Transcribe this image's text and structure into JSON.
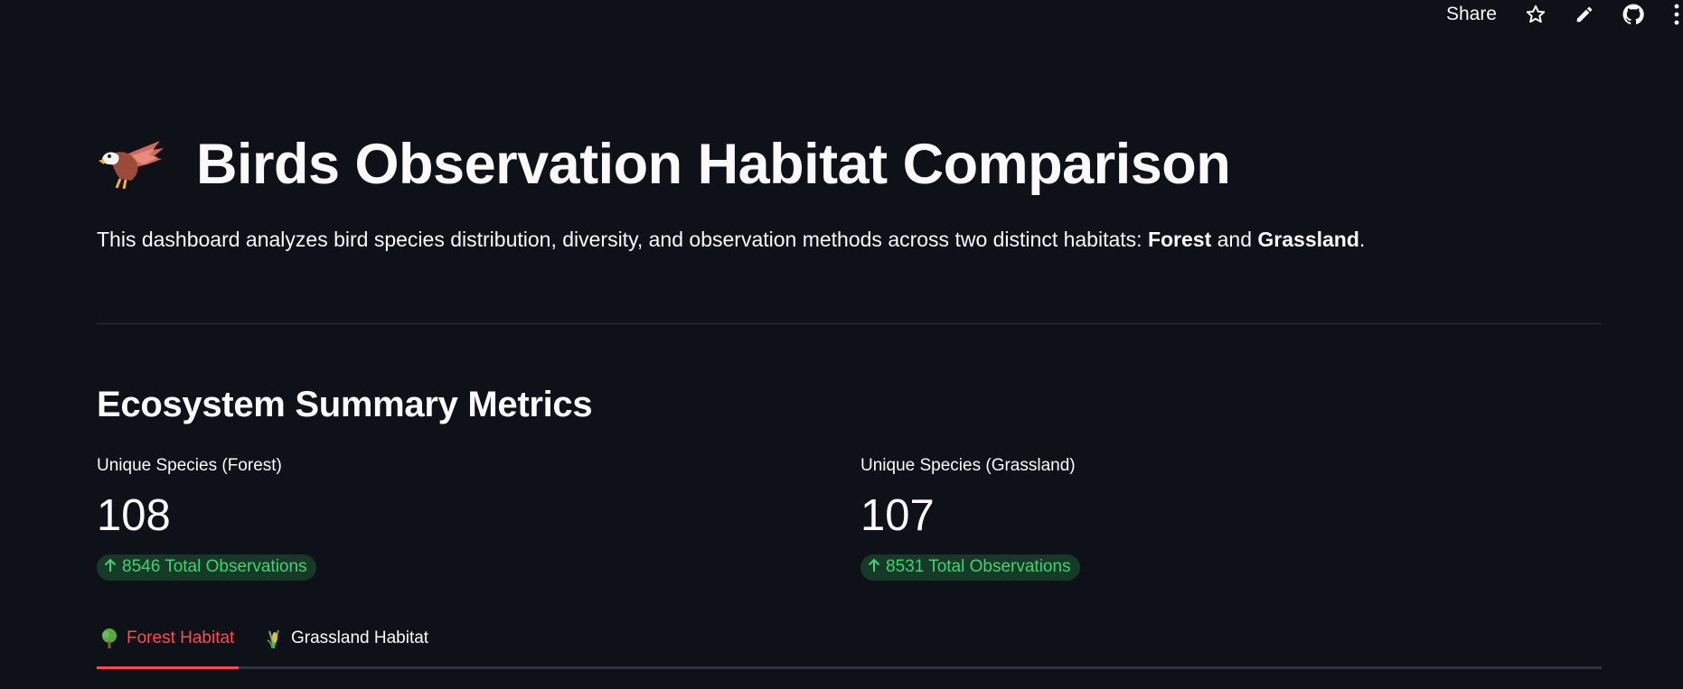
{
  "toolbar": {
    "share_label": "Share",
    "icons": [
      "star-icon",
      "pencil-icon",
      "github-icon",
      "more-vertical-icon"
    ]
  },
  "header": {
    "title": "Birds Observation Habitat Comparison",
    "title_icon": "eagle-icon"
  },
  "description": {
    "prefix": "This dashboard analyzes bird species distribution, diversity, and observation methods across two distinct habitats: ",
    "habitat_1": "Forest",
    "middle": " and ",
    "habitat_2": "Grassland",
    "suffix": "."
  },
  "summary": {
    "heading": "Ecosystem Summary Metrics",
    "metrics": [
      {
        "label": "Unique Species (Forest)",
        "value": "108",
        "delta": "8546 Total Observations"
      },
      {
        "label": "Unique Species (Grassland)",
        "value": "107",
        "delta": "8531 Total Observations"
      }
    ]
  },
  "tabs": [
    {
      "label": "Forest Habitat",
      "icon": "tree-icon",
      "active": true
    },
    {
      "label": "Grassland Habitat",
      "icon": "grass-icon",
      "active": false
    }
  ],
  "colors": {
    "background": "#0e1117",
    "accent": "#ff4b4b",
    "delta_text": "#3dd56d",
    "delta_bg": "#173928",
    "divider": "#31333f"
  }
}
